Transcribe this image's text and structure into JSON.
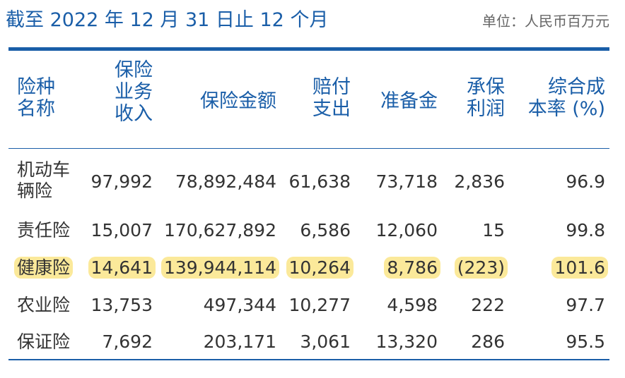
{
  "title": "截至 2022 年 12 月 31 日止 12 个月",
  "unit": "单位：人民币百万元",
  "header": {
    "type": [
      "险种",
      "名称"
    ],
    "premium": [
      "保险",
      "业务",
      "收入"
    ],
    "insured": [
      "保险金额"
    ],
    "claims": [
      "赔付",
      "支出"
    ],
    "reserve": [
      "准备金"
    ],
    "profit": [
      "承保",
      "利润"
    ],
    "ratio": [
      "综合成",
      "本率 (%)"
    ]
  },
  "rows": [
    {
      "name": [
        "机动车",
        "辆险"
      ],
      "premium": "97,992",
      "insured": "78,892,484",
      "claims": "61,638",
      "reserve": "73,718",
      "profit": "2,836",
      "ratio": "96.9"
    },
    {
      "name": [
        "责任险"
      ],
      "premium": "15,007",
      "insured": "170,627,892",
      "claims": "6,586",
      "reserve": "12,060",
      "profit": "15",
      "ratio": "99.8"
    },
    {
      "name": [
        "健康险"
      ],
      "premium": "14,641",
      "insured": "139,944,114",
      "claims": "10,264",
      "reserve": "8,786",
      "profit": "(223)",
      "ratio": "101.6"
    },
    {
      "name": [
        "农业险"
      ],
      "premium": "13,753",
      "insured": "497,344",
      "claims": "10,277",
      "reserve": "4,598",
      "profit": "222",
      "ratio": "97.7"
    },
    {
      "name": [
        "保证险"
      ],
      "premium": "7,692",
      "insured": "203,171",
      "claims": "3,061",
      "reserve": "13,320",
      "profit": "286",
      "ratio": "95.5"
    }
  ],
  "colors": {
    "accent": "#1a5ea8",
    "highlight": "#fbe99a",
    "text": "#333333"
  }
}
